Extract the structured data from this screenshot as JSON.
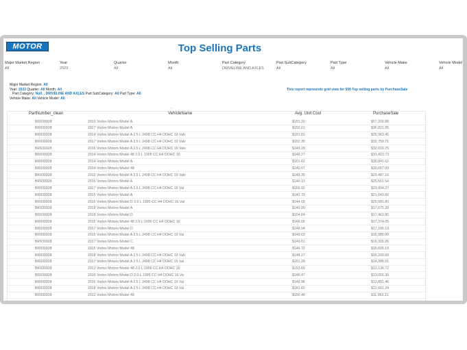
{
  "header": {
    "logo_text": "MOTOR",
    "title": "Top Selling Parts"
  },
  "filters": [
    {
      "label": "Major Market Region",
      "value": "All"
    },
    {
      "label": "Year",
      "value": "2023"
    },
    {
      "label": "Quarter",
      "value": "All"
    },
    {
      "label": "Month",
      "value": "All"
    },
    {
      "label": "Part Category",
      "value": "DRIVELINE AND AXLES"
    },
    {
      "label": "Part SubCategory",
      "value": "All"
    },
    {
      "label": "Part Type",
      "value": "All"
    },
    {
      "label": "Vehicle Make",
      "value": "All"
    },
    {
      "label": "Vehicle Model",
      "value": "All"
    }
  ],
  "summary": {
    "region_label": "Major Market Region:",
    "region_value": "All",
    "year_label": "Year:",
    "year_value": "2023",
    "quarter_label": "Quarter:",
    "quarter_value": "All",
    "month_label": "Month:",
    "month_value": "All",
    "category_label": "Part Category:",
    "category_value": "Null, , DRIVELINE AND AXLES",
    "subcategory_label": "Part SubCategory:",
    "subcategory_value": "All",
    "type_label": "Part Type:",
    "type_value": "All",
    "make_label": "Vehicle Make:",
    "make_value": "All",
    "model_label": "Vehicle Model:",
    "model_value": "All"
  },
  "note": "This report represents grid view for 500 Top selling parts by PurchaseSale",
  "scroll_marker": "...",
  "table": {
    "headers": [
      "PartNumber_clean",
      "VehicleName",
      "Avg. Unit Cost",
      "PurchaseSale"
    ],
    "rows": [
      [
        "BR930928",
        "2015 Vortex Motors Model A",
        "$151.20",
        "$57,205.88"
      ],
      [
        "BR930928",
        "2017 Vortex Motors Model A",
        "$152.61",
        "$36,821.95"
      ],
      [
        "BR930928",
        "2014 Vortex Motors Model A 2.5 L 2498 CC H4 DOHC 16 Valv",
        "$151.81",
        "$35,963.45"
      ],
      [
        "BR930928",
        "2017 Vortex Motors Model A 2.5 L 2498 CC H4 DOHC 16 Valv",
        "$152.35",
        "$32,759.71"
      ],
      [
        "BR930928",
        "2016 Vortex Motors Model A 2.5 L 2498 CC H4 DOHC 16 Valv",
        "$149.28",
        "$32,019.75"
      ],
      [
        "BR930928",
        "2014 Vortex Motors Model 48 2.0 L 1995 CC H4 DOHC 16",
        "$149.27",
        "$31,423.73"
      ],
      [
        "BR930928",
        "2014 Vortex Motors Model A",
        "$151.62",
        "$30,841.62"
      ],
      [
        "BR930928",
        "2014 Vortex Motors Model 48",
        "$140.07",
        "$30,657.09"
      ],
      [
        "BR930928",
        "2015 Vortex Motors Model A 2.5 L 2498 CC H4 DOHC 16 Valv",
        "$149.35",
        "$29,487.16"
      ],
      [
        "BR930928",
        "2016 Vortex Motors Model A",
        "$140.13",
        "$25,561.54"
      ],
      [
        "BR930928",
        "2017 Vortex Motors Model A 2.5 L 2498 CC H4 DOHC 16 Val",
        "$150.92",
        "$23,994.27"
      ],
      [
        "BR930928",
        "2015 Vortex Motors Model A",
        "$142.79",
        "$21,643.82"
      ],
      [
        "BR930928",
        "2016 Vortex Motors Model D 2.0 L 1995 CC H4 DOHC 16 Val",
        "$144.09",
        "$20,581.80"
      ],
      [
        "BR930928",
        "2018 Vortex Motors Model A",
        "$149.00",
        "$17,675.39"
      ],
      [
        "BR930928",
        "2018 Vortex Motors Model D",
        "$154.64",
        "$17,463.80"
      ],
      [
        "BR930928",
        "2015 Vortex Motors Model 48 2.0 L 1995 CC H4 DOHC 16",
        "$146.05",
        "$17,374.05"
      ],
      [
        "BR930928",
        "2017 Vortex Motors Model D",
        "$148.94",
        "$17,195.19"
      ],
      [
        "BR930928",
        "2015 Vortex Motors Model A 2.5 L 2498 CC H4 DOHC 16 Val",
        "$149.03",
        "$16,985.00"
      ],
      [
        "BR930928",
        "2017 Vortex Motors Model C",
        "$149.61",
        "$16,316.26"
      ],
      [
        "BR930928",
        "2015 Vortex Motors Model 48",
        "$146.72",
        "$15,695.10"
      ],
      [
        "BR930928",
        "2018 Vortex Motors Model A 2.5 L 2498 CC H4 DOHC 16 Valv",
        "$148.27",
        "$15,209.60"
      ],
      [
        "BR930928",
        "2017 Vortex Motors Model A 2.5 L 2498 CC H4 DOHC 16 Val",
        "$151.28",
        "$14,386.51"
      ],
      [
        "BR930928",
        "2013 Vortex Motors Model 48 2.0 L 1995 CC H4 DOHC 16",
        "$153.69",
        "$13,136.72"
      ],
      [
        "BR930928",
        "2016 Vortex Motors Model D 2.0 L 1995 CC H4 DOHC 16 Va",
        "$146.47",
        "$13,055.30"
      ],
      [
        "BR930928",
        "2016 Vortex Motors Model A 2.5 L 2498 CC H4 DOHC 16 Val",
        "$149.96",
        "$12,891.46"
      ],
      [
        "BR930928",
        "2018 Vortex Motors Model A 2.5 L 2498 CC H4 DOHC 16 Val",
        "$161.60",
        "$12,661.24"
      ],
      [
        "BR930928",
        "2013 Vortex Motors Model 48",
        "$150.46",
        "$11,953.31"
      ]
    ]
  }
}
